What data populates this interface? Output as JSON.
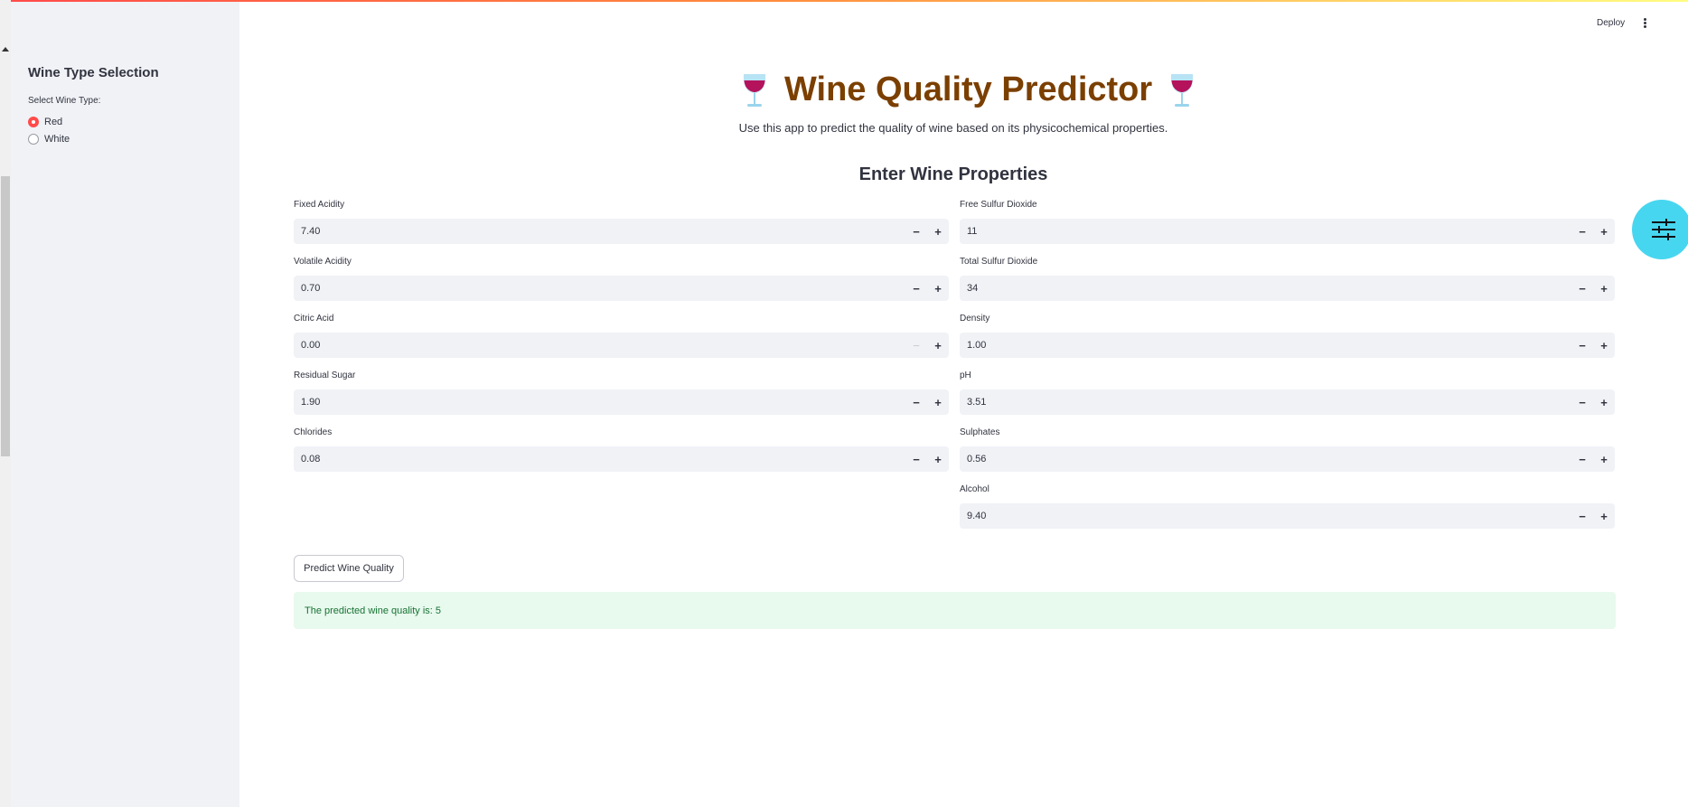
{
  "sidebar": {
    "title": "Wine Type Selection",
    "select_label": "Select Wine Type:",
    "options": [
      {
        "label": "Red",
        "selected": true
      },
      {
        "label": "White",
        "selected": false
      }
    ]
  },
  "header": {
    "deploy_label": "Deploy",
    "menu_icon": "kebab-menu-icon"
  },
  "main": {
    "title": "Wine Quality Predictor",
    "title_icon": "wine-glass-icon",
    "subtitle": "Use this app to predict the quality of wine based on its physicochemical properties.",
    "section_title": "Enter Wine Properties",
    "left_fields": [
      {
        "label": "Fixed Acidity",
        "value": "7.40"
      },
      {
        "label": "Volatile Acidity",
        "value": "0.70"
      },
      {
        "label": "Citric Acid",
        "value": "0.00",
        "minus_disabled": true
      },
      {
        "label": "Residual Sugar",
        "value": "1.90"
      },
      {
        "label": "Chlorides",
        "value": "0.08"
      }
    ],
    "right_fields": [
      {
        "label": "Free Sulfur Dioxide",
        "value": "11"
      },
      {
        "label": "Total Sulfur Dioxide",
        "value": "34"
      },
      {
        "label": "Density",
        "value": "1.00"
      },
      {
        "label": "pH",
        "value": "3.51"
      },
      {
        "label": "Sulphates",
        "value": "0.56"
      },
      {
        "label": "Alcohol",
        "value": "9.40"
      }
    ],
    "stepper_minus": "−",
    "stepper_plus": "+",
    "predict_button": "Predict Wine Quality",
    "result_text": "The predicted wine quality is: 5"
  },
  "colors": {
    "accent": "#ff4b4b",
    "title": "#7b3f00",
    "sidebar_bg": "#f0f2f6",
    "success_bg": "#e8f9ee",
    "success_text": "#177233",
    "fab": "#47d6f0"
  }
}
